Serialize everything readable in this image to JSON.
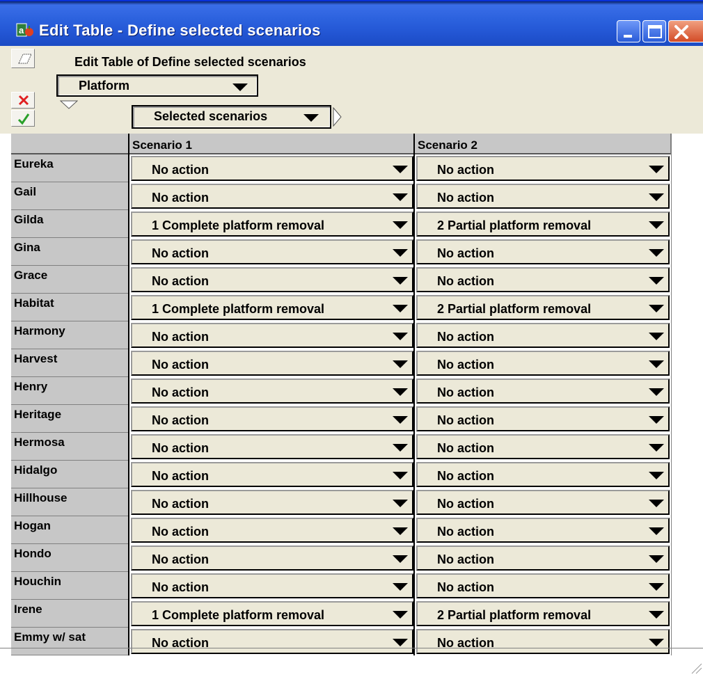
{
  "window": {
    "title": "Edit Table - Define selected scenarios",
    "icon": "analytica-app-icon",
    "controls": [
      "minimize-icon",
      "maximize-icon",
      "close-icon"
    ]
  },
  "toolbar": {
    "heading": "Edit Table of Define selected scenarios",
    "index1_dropdown": "Platform",
    "index2_dropdown": "Selected scenarios",
    "buttons": [
      "edit-shape-icon",
      "cancel-x-icon",
      "accept-check-icon"
    ]
  },
  "table": {
    "columns": [
      "",
      "Scenario 1",
      "Scenario 2"
    ],
    "rows": [
      {
        "label": "Eureka",
        "s1": "No action",
        "s2": "No action"
      },
      {
        "label": "Gail",
        "s1": "No action",
        "s2": "No action"
      },
      {
        "label": "Gilda",
        "s1": "1 Complete platform removal",
        "s2": "2 Partial platform removal"
      },
      {
        "label": "Gina",
        "s1": "No action",
        "s2": "No action"
      },
      {
        "label": "Grace",
        "s1": "No action",
        "s2": "No action"
      },
      {
        "label": "Habitat",
        "s1": "1 Complete platform removal",
        "s2": "2 Partial platform removal"
      },
      {
        "label": "Harmony",
        "s1": "No action",
        "s2": "No action"
      },
      {
        "label": "Harvest",
        "s1": "No action",
        "s2": "No action"
      },
      {
        "label": "Henry",
        "s1": "No action",
        "s2": "No action"
      },
      {
        "label": "Heritage",
        "s1": "No action",
        "s2": "No action"
      },
      {
        "label": "Hermosa",
        "s1": "No action",
        "s2": "No action"
      },
      {
        "label": "Hidalgo",
        "s1": "No action",
        "s2": "No action"
      },
      {
        "label": "Hillhouse",
        "s1": "No action",
        "s2": "No action"
      },
      {
        "label": "Hogan",
        "s1": "No action",
        "s2": "No action"
      },
      {
        "label": "Hondo",
        "s1": "No action",
        "s2": "No action"
      },
      {
        "label": "Houchin",
        "s1": "No action",
        "s2": "No action"
      },
      {
        "label": "Irene",
        "s1": "1 Complete platform removal",
        "s2": "2 Partial platform removal"
      },
      {
        "label": "Emmy w/ sat",
        "s1": "No action",
        "s2": "No action"
      }
    ]
  },
  "colors": {
    "titlebar": "#2356d4",
    "panel": "#ece9d8",
    "row_header": "#c7c7c7",
    "close_button": "#d34b26"
  }
}
